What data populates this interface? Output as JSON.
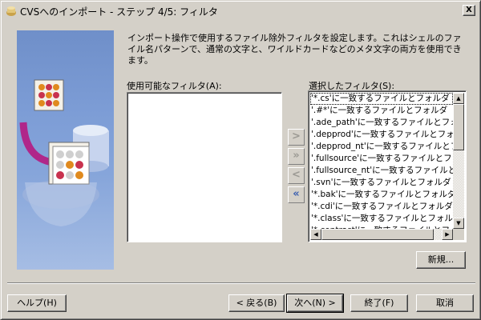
{
  "window": {
    "title": "CVSへのインポート - ステップ 4/5: フィルタ",
    "close_glyph": "X"
  },
  "description": "インポート操作で使用するファイル除外フィルタを設定します。これはシェルのファイル名パターンで、通常の文字と、ワイルドカードなどのメタ文字の両方を使用できます。",
  "available": {
    "label": "使用可能なフィルタ(A):",
    "items": []
  },
  "selected": {
    "label": "選択したフィルタ(S):",
    "items": [
      "'*.cs'に一致するファイルとフォルダ",
      "'.#*'に一致するファイルとフォルダ",
      "'.ade_path'に一致するファイルとフォルダ",
      "'.depprod'に一致するファイルとフォルダ",
      "'.depprod_nt'に一致するファイルとフォルダ",
      "'.fullsource'に一致するファイルとフォルダ",
      "'.fullsource_nt'に一致するファイルとフォルダ",
      "'.svn'に一致するファイルとフォルダ",
      "'*.bak'に一致するファイルとフォルダ",
      "'*.cdi'に一致するファイルとフォルダ",
      "'*.class'に一致するファイルとフォルダ",
      "'*.contrast'に一致するファイルとフォルダ"
    ]
  },
  "move_buttons": {
    "add": ">",
    "add_all": "»",
    "remove": "<",
    "remove_all": "«"
  },
  "buttons": {
    "new": "新規...",
    "help": "ヘルプ(H)",
    "back": "< 戻る(B)",
    "next": "次へ(N) >",
    "finish": "終了(F)",
    "cancel": "取消"
  }
}
